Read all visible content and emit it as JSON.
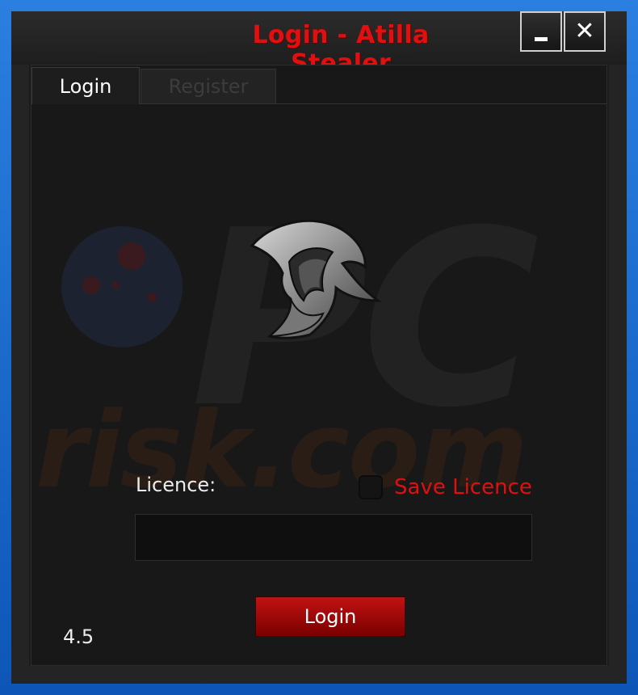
{
  "window": {
    "title": "Login - Atilla Stealer",
    "minimize_glyph": "_",
    "close_glyph": "✕"
  },
  "tabs": [
    {
      "label": "Login",
      "active": true
    },
    {
      "label": "Register",
      "active": false
    }
  ],
  "logo": {
    "icon": "spartan-helmet-icon"
  },
  "form": {
    "licence_label": "Licence:",
    "save_label": "Save Licence",
    "save_checked": false,
    "licence_value": "",
    "login_button": "Login"
  },
  "version": "4.5",
  "watermark": {
    "top": "PC",
    "bottom": "risk.com"
  },
  "colors": {
    "accent_red": "#e01010",
    "window_bg": "#1b1b1b",
    "border_blue": "#1a6fd0"
  }
}
